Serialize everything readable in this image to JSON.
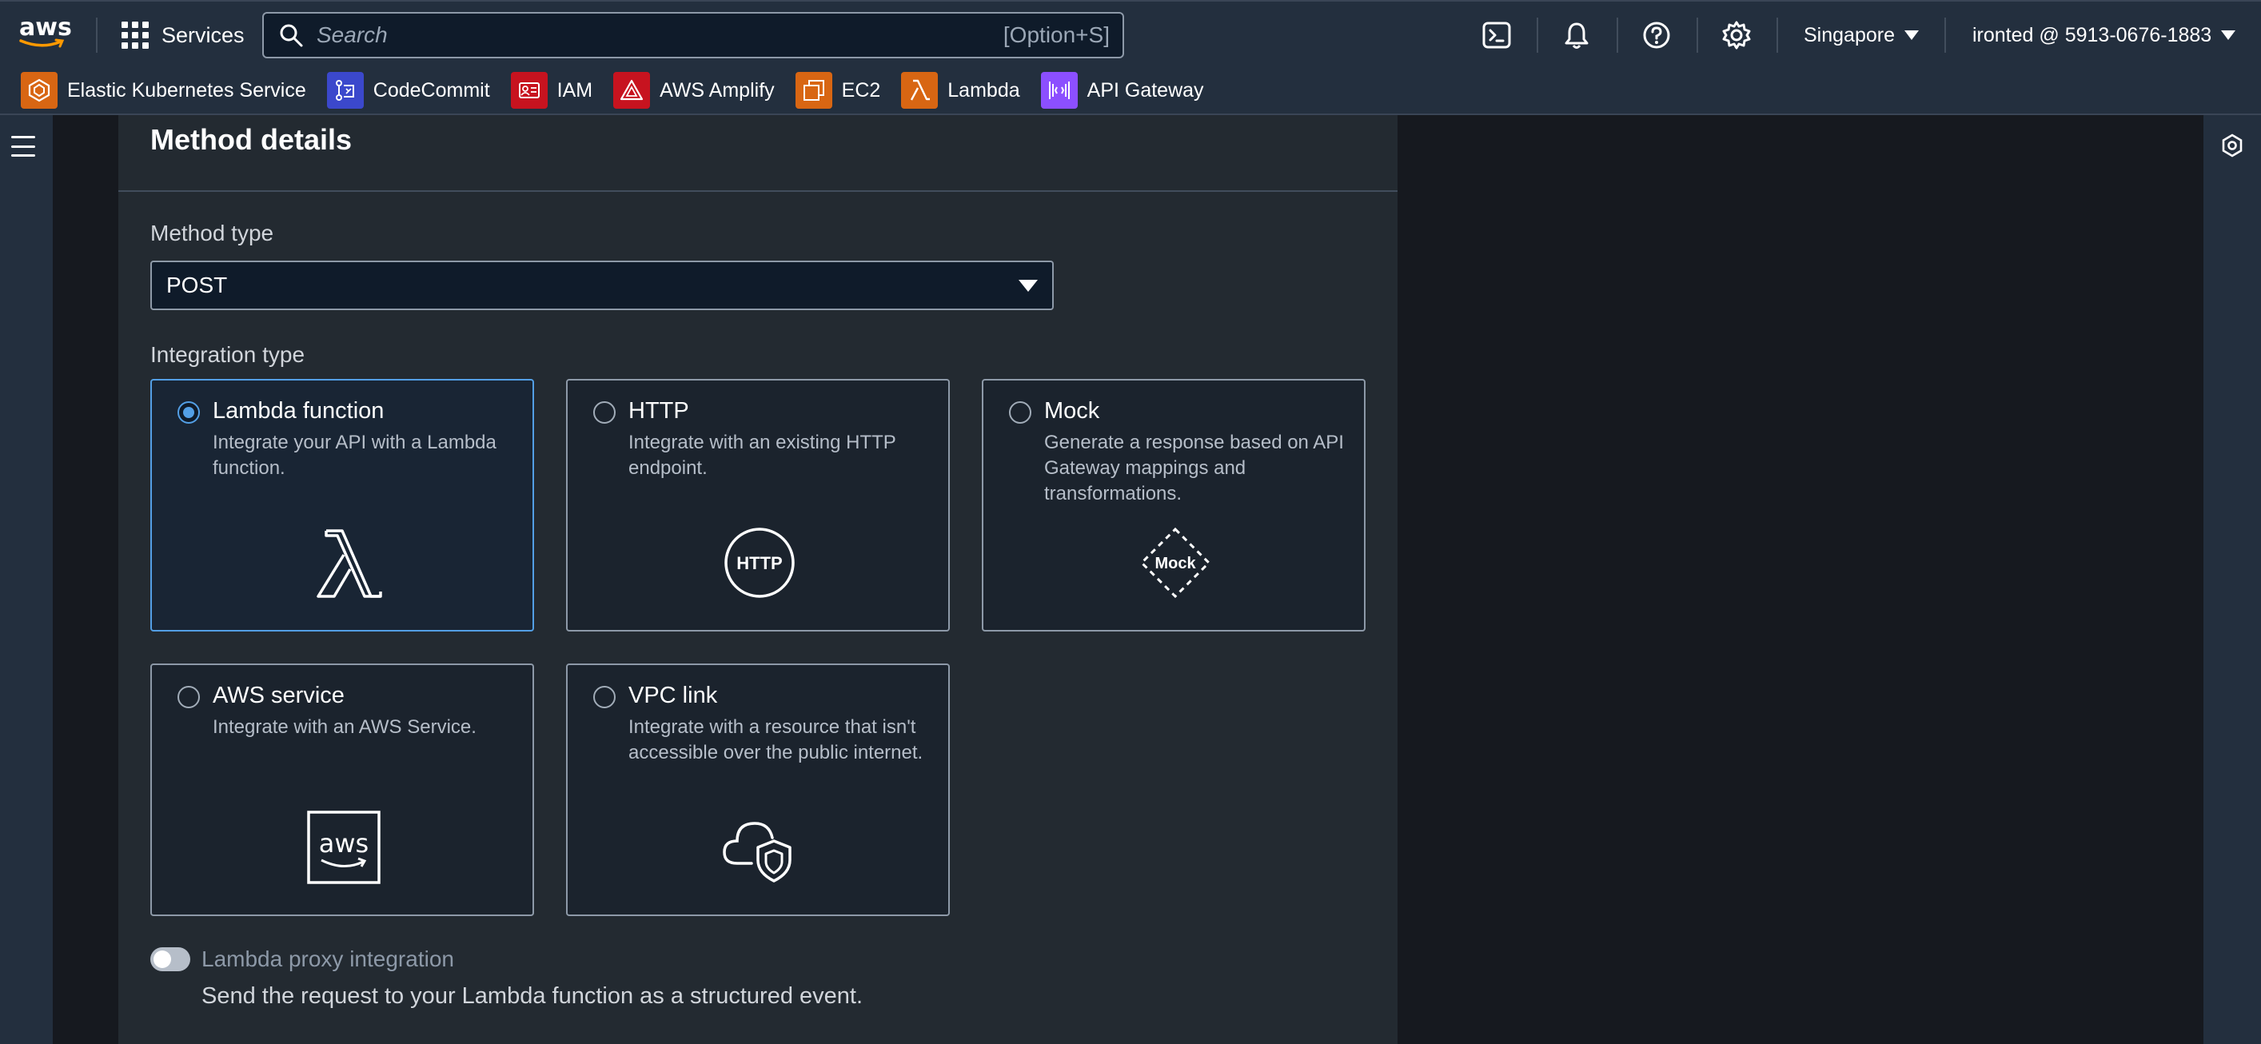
{
  "topnav": {
    "logo_text": "aws",
    "services_label": "Services",
    "search_placeholder": "Search",
    "search_shortcut": "[Option+S]",
    "region": "Singapore",
    "account": "ironted @ 5913-0676-1883",
    "icons": [
      "cloudshell-icon",
      "notifications-bell-icon",
      "help-icon",
      "settings-gear-icon"
    ]
  },
  "favorites": [
    {
      "label": "Elastic Kubernetes Service",
      "icon": "eks-icon",
      "color": "#d86613"
    },
    {
      "label": "CodeCommit",
      "icon": "codecommit-icon",
      "color": "#3b48cc"
    },
    {
      "label": "IAM",
      "icon": "iam-icon",
      "color": "#c7131f"
    },
    {
      "label": "AWS Amplify",
      "icon": "amplify-icon",
      "color": "#c7131f"
    },
    {
      "label": "EC2",
      "icon": "ec2-icon",
      "color": "#d86613"
    },
    {
      "label": "Lambda",
      "icon": "lambda-icon",
      "color": "#d86613"
    },
    {
      "label": "API Gateway",
      "icon": "api-gateway-icon",
      "color": "#8c4fff"
    }
  ],
  "panel": {
    "title": "Method details",
    "method_type_label": "Method type",
    "method_type_value": "POST",
    "integration_type_label": "Integration type",
    "options": [
      {
        "title": "Lambda function",
        "desc": "Integrate your API with a Lambda function.",
        "selected": true
      },
      {
        "title": "HTTP",
        "desc": "Integrate with an existing HTTP endpoint.",
        "art_text": "HTTP",
        "selected": false
      },
      {
        "title": "Mock",
        "desc": "Generate a response based on API Gateway mappings and transformations.",
        "art_text": "Mock",
        "selected": false
      },
      {
        "title": "AWS service",
        "desc": "Integrate with an AWS Service.",
        "art_text": "aws",
        "selected": false
      },
      {
        "title": "VPC link",
        "desc": "Integrate with a resource that isn't accessible over the public internet.",
        "selected": false
      }
    ],
    "proxy_label": "Lambda proxy integration",
    "proxy_enabled": false,
    "proxy_desc": "Send the request to your Lambda function as a structured event."
  },
  "colors": {
    "nav_bg": "#232f3e",
    "page_bg": "#16191f",
    "panel_bg": "#232a31",
    "selected_accent": "#539fe5"
  }
}
